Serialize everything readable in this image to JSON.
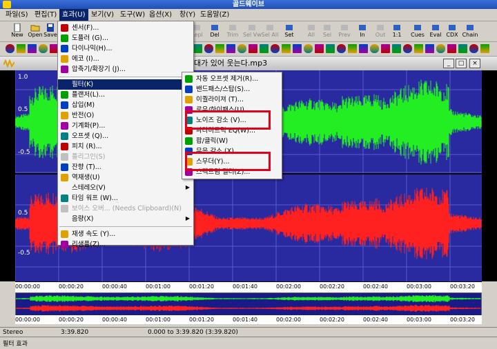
{
  "app": {
    "title": "골드웨이브",
    "document_title": "l대가 있어 웃는다.mp3"
  },
  "menubar": [
    {
      "label": "파일(S)"
    },
    {
      "label": "편집(T)"
    },
    {
      "label": "효과(U)"
    },
    {
      "label": "보기(V)"
    },
    {
      "label": "도구(W)"
    },
    {
      "label": "옵션(X)"
    },
    {
      "label": "창(Y)"
    },
    {
      "label": "도움말(Z)"
    }
  ],
  "toolbar": {
    "left": [
      {
        "label": "New"
      },
      {
        "label": "Open"
      },
      {
        "label": "Save"
      }
    ],
    "right": [
      {
        "label": "Repl",
        "disabled": true
      },
      {
        "label": "Del",
        "disabled": false
      },
      {
        "label": "Trim",
        "disabled": true
      },
      {
        "label": "Sel Vw",
        "disabled": true
      },
      {
        "label": "Sel All",
        "disabled": true
      },
      {
        "label": "Set",
        "disabled": false
      },
      {
        "label": "All",
        "disabled": true
      },
      {
        "label": "Sel",
        "disabled": true
      },
      {
        "label": "Prev",
        "disabled": true
      },
      {
        "label": "In",
        "disabled": false
      },
      {
        "label": "Out",
        "disabled": true
      },
      {
        "label": "1:1",
        "disabled": false
      },
      {
        "label": "Cues",
        "disabled": false
      },
      {
        "label": "Eval",
        "disabled": false
      },
      {
        "label": "CDX",
        "disabled": false
      },
      {
        "label": "Chain",
        "disabled": false
      }
    ]
  },
  "effects_menu": [
    {
      "label": "센서(F)...",
      "disabled": false,
      "icon": "censor-icon"
    },
    {
      "label": "도플러 (G)...",
      "disabled": false,
      "icon": "doppler-icon"
    },
    {
      "label": "다이나믹(H)...",
      "disabled": false,
      "icon": "dynamics-icon"
    },
    {
      "label": "에코 (I)...",
      "disabled": false,
      "icon": "echo-icon"
    },
    {
      "label": "압축기/확장기 (J)...",
      "disabled": false,
      "icon": "compressor-icon"
    },
    {
      "sep": true
    },
    {
      "label": "필터(K)",
      "submenu": true,
      "selected": true,
      "icon": ""
    },
    {
      "label": "플랜저(L)...",
      "disabled": false,
      "icon": "flanger-icon"
    },
    {
      "label": "삽입(M)",
      "disabled": false,
      "icon": "insert-icon"
    },
    {
      "label": "반전(O)",
      "disabled": false,
      "icon": "invert-icon"
    },
    {
      "label": "기계화(P)...",
      "disabled": false,
      "icon": "mechanize-icon"
    },
    {
      "label": "오프셋 (Q)...",
      "disabled": false,
      "icon": "offset-icon"
    },
    {
      "label": "피치 (R)...",
      "disabled": false,
      "icon": "pitch-icon"
    },
    {
      "label": "플리그인(S)",
      "disabled": true,
      "icon": "plugin-icon"
    },
    {
      "label": "잔향 (T)...",
      "disabled": false,
      "icon": "reverb-icon"
    },
    {
      "label": "역재생(U)",
      "disabled": false,
      "icon": "reverse-icon"
    },
    {
      "label": "스테레오(V)",
      "submenu": true,
      "icon": ""
    },
    {
      "label": "타임 워프 (W)...",
      "disabled": false,
      "icon": "timewarp-icon"
    },
    {
      "label": "보이스 오버... (Needs Clipboard)(N)",
      "disabled": true,
      "icon": "voiceover-icon"
    },
    {
      "label": "음량(X)",
      "submenu": true,
      "icon": ""
    },
    {
      "sep": true
    },
    {
      "label": "재생 속도 (Y)...",
      "disabled": false,
      "icon": "playback-rate-icon"
    },
    {
      "label": "리샘플(Z)...",
      "disabled": false,
      "icon": "resample-icon"
    }
  ],
  "filter_menu": [
    {
      "label": "자동 오프셋 제거(R)..."
    },
    {
      "label": "밴드패스/스탑(S)..."
    },
    {
      "label": "이퀄라이져 (T)..."
    },
    {
      "label": "로우/하이패스(U)..."
    },
    {
      "label": "노이즈 감소 (V)..."
    },
    {
      "label": "파라미트릭 EQ(W)..."
    },
    {
      "label": "팝/클릭(W)"
    },
    {
      "label": "무음 감소 (X)..."
    },
    {
      "label": "스무더(Y)..."
    },
    {
      "label": "스펙트럼 필터(Z)..."
    }
  ],
  "wave": {
    "y_labels_top": [
      "1.0",
      "0.5",
      "-0.5"
    ],
    "y_labels_bottom": [
      "0.5",
      "-0.5"
    ],
    "top_color": "#22ee22",
    "bottom_color": "#ff2020"
  },
  "timeline": [
    "00:00:00",
    "00:00:20",
    "00:00:40",
    "00:01:00",
    "00:01:20",
    "00:01:40",
    "00:02:00",
    "00:02:20",
    "00:02:40",
    "00:03:00",
    "00:03:20"
  ],
  "status": {
    "channel": "Stereo",
    "length": "3:39.820",
    "selection": "0.000 to 3:39.820 (3:39.820)",
    "footer": "필터 효과"
  }
}
